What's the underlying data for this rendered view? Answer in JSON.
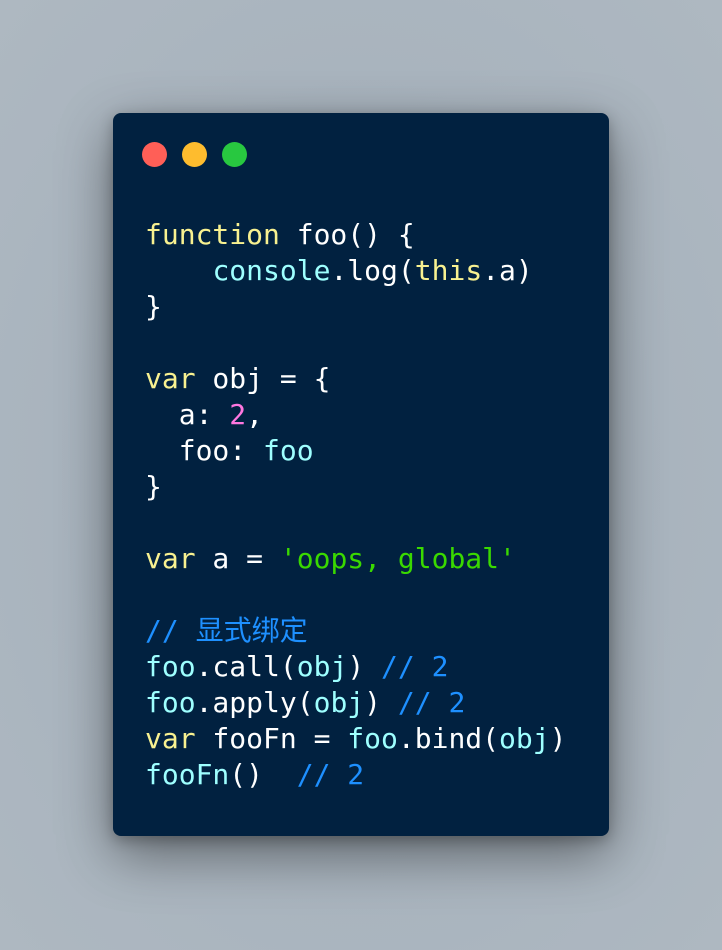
{
  "colors": {
    "background": "#a8b3bd",
    "editor_background": "#012140",
    "traffic_light_close": "#ff5f57",
    "traffic_light_minimize": "#febc2e",
    "traffic_light_zoom": "#28c840",
    "keyword": "#f8f190",
    "plain": "#ffffff",
    "builtin": "#9effff",
    "number": "#ff77e0",
    "string": "#3ad900",
    "comment": "#1e90ff"
  },
  "window": {
    "buttons": [
      {
        "name": "close",
        "color": "#ff5f57"
      },
      {
        "name": "minimize",
        "color": "#febc2e"
      },
      {
        "name": "zoom",
        "color": "#28c840"
      }
    ]
  },
  "code": {
    "language": "javascript",
    "lines": [
      [
        {
          "t": "function",
          "k": "keyword"
        },
        {
          "t": " foo() {",
          "k": "plain"
        }
      ],
      [
        {
          "t": "    ",
          "k": "plain"
        },
        {
          "t": "console",
          "k": "builtin"
        },
        {
          "t": ".log(",
          "k": "plain"
        },
        {
          "t": "this",
          "k": "keyword"
        },
        {
          "t": ".a)",
          "k": "plain"
        }
      ],
      [
        {
          "t": "}",
          "k": "plain"
        }
      ],
      [],
      [
        {
          "t": "var",
          "k": "keyword"
        },
        {
          "t": " obj = {",
          "k": "plain"
        }
      ],
      [
        {
          "t": "  a: ",
          "k": "plain"
        },
        {
          "t": "2",
          "k": "number"
        },
        {
          "t": ",",
          "k": "plain"
        }
      ],
      [
        {
          "t": "  foo: ",
          "k": "plain"
        },
        {
          "t": "foo",
          "k": "builtin"
        }
      ],
      [
        {
          "t": "}",
          "k": "plain"
        }
      ],
      [],
      [
        {
          "t": "var",
          "k": "keyword"
        },
        {
          "t": " a = ",
          "k": "plain"
        },
        {
          "t": "'oops, global'",
          "k": "string"
        }
      ],
      [],
      [
        {
          "t": "// 显式绑定",
          "k": "comment"
        }
      ],
      [
        {
          "t": "foo",
          "k": "builtin"
        },
        {
          "t": ".call(",
          "k": "plain"
        },
        {
          "t": "obj",
          "k": "builtin"
        },
        {
          "t": ") ",
          "k": "plain"
        },
        {
          "t": "// 2",
          "k": "comment"
        }
      ],
      [
        {
          "t": "foo",
          "k": "builtin"
        },
        {
          "t": ".apply(",
          "k": "plain"
        },
        {
          "t": "obj",
          "k": "builtin"
        },
        {
          "t": ") ",
          "k": "plain"
        },
        {
          "t": "// 2",
          "k": "comment"
        }
      ],
      [
        {
          "t": "var",
          "k": "keyword"
        },
        {
          "t": " fooFn = ",
          "k": "plain"
        },
        {
          "t": "foo",
          "k": "builtin"
        },
        {
          "t": ".bind(",
          "k": "plain"
        },
        {
          "t": "obj",
          "k": "builtin"
        },
        {
          "t": ")",
          "k": "plain"
        }
      ],
      [
        {
          "t": "fooFn",
          "k": "builtin"
        },
        {
          "t": "()  ",
          "k": "plain"
        },
        {
          "t": "// 2",
          "k": "comment"
        }
      ]
    ]
  }
}
